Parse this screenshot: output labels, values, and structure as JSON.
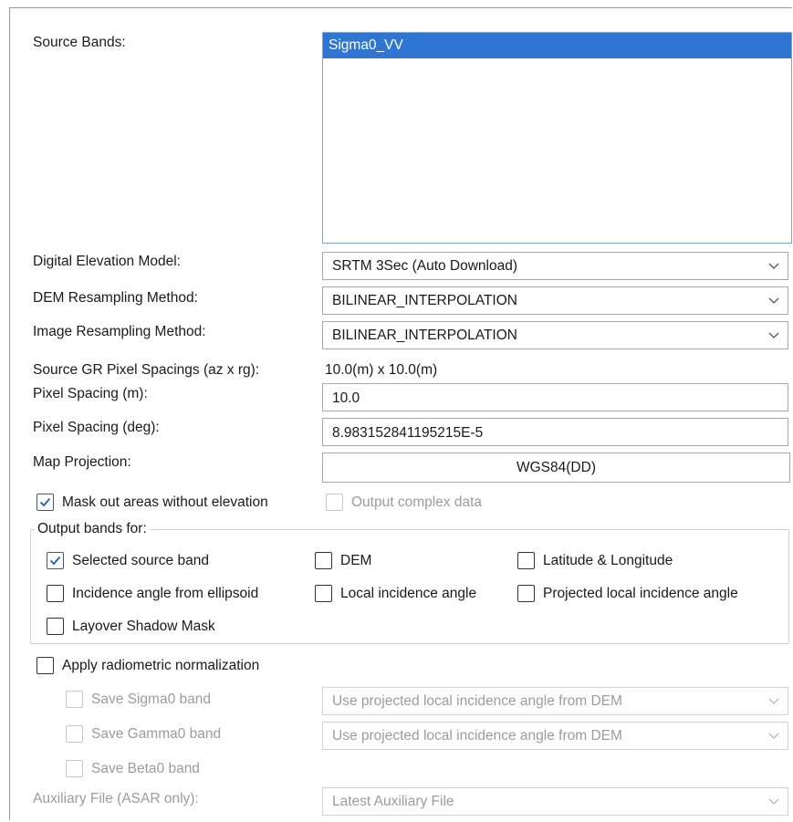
{
  "source_bands": {
    "label": "Source Bands:",
    "items": [
      "Sigma0_VV"
    ]
  },
  "dem": {
    "label": "Digital Elevation Model:",
    "value": "SRTM 3Sec (Auto Download)"
  },
  "dem_resampling": {
    "label": "DEM Resampling Method:",
    "value": "BILINEAR_INTERPOLATION"
  },
  "image_resampling": {
    "label": "Image Resampling Method:",
    "value": "BILINEAR_INTERPOLATION"
  },
  "source_gr": {
    "label": "Source GR Pixel Spacings (az x rg):",
    "value": "10.0(m) x 10.0(m)"
  },
  "pixel_spacing_m": {
    "label": "Pixel Spacing (m):",
    "value": "10.0"
  },
  "pixel_spacing_deg": {
    "label": "Pixel Spacing (deg):",
    "value": "8.983152841195215E-5"
  },
  "map_projection": {
    "label": "Map Projection:",
    "value": "WGS84(DD)"
  },
  "mask_out": {
    "label": "Mask out areas without elevation",
    "checked": true
  },
  "output_complex": {
    "label": "Output complex data",
    "checked": false
  },
  "output_bands": {
    "title": "Output bands for:",
    "selected_source_band": {
      "label": "Selected source band",
      "checked": true
    },
    "dem": {
      "label": "DEM",
      "checked": false
    },
    "lat_lon": {
      "label": "Latitude & Longitude",
      "checked": false
    },
    "incidence_ellipsoid": {
      "label": "Incidence angle from ellipsoid",
      "checked": false
    },
    "local_incidence": {
      "label": "Local incidence angle",
      "checked": false
    },
    "projected_local_incidence": {
      "label": "Projected local incidence angle",
      "checked": false
    },
    "layover_shadow": {
      "label": "Layover Shadow Mask",
      "checked": false
    }
  },
  "radiometric": {
    "label": "Apply radiometric normalization",
    "checked": false,
    "save_sigma0": {
      "label": "Save Sigma0 band",
      "option": "Use projected local incidence angle from DEM"
    },
    "save_gamma0": {
      "label": "Save Gamma0 band",
      "option": "Use projected local incidence angle from DEM"
    },
    "save_beta0": {
      "label": "Save Beta0 band"
    },
    "aux_file": {
      "label": "Auxiliary File (ASAR only):",
      "value": "Latest Auxiliary File"
    }
  },
  "colors": {
    "selection": "#2f76d3",
    "check": "#1f5fb8",
    "disabled": "#9c9c9c"
  }
}
